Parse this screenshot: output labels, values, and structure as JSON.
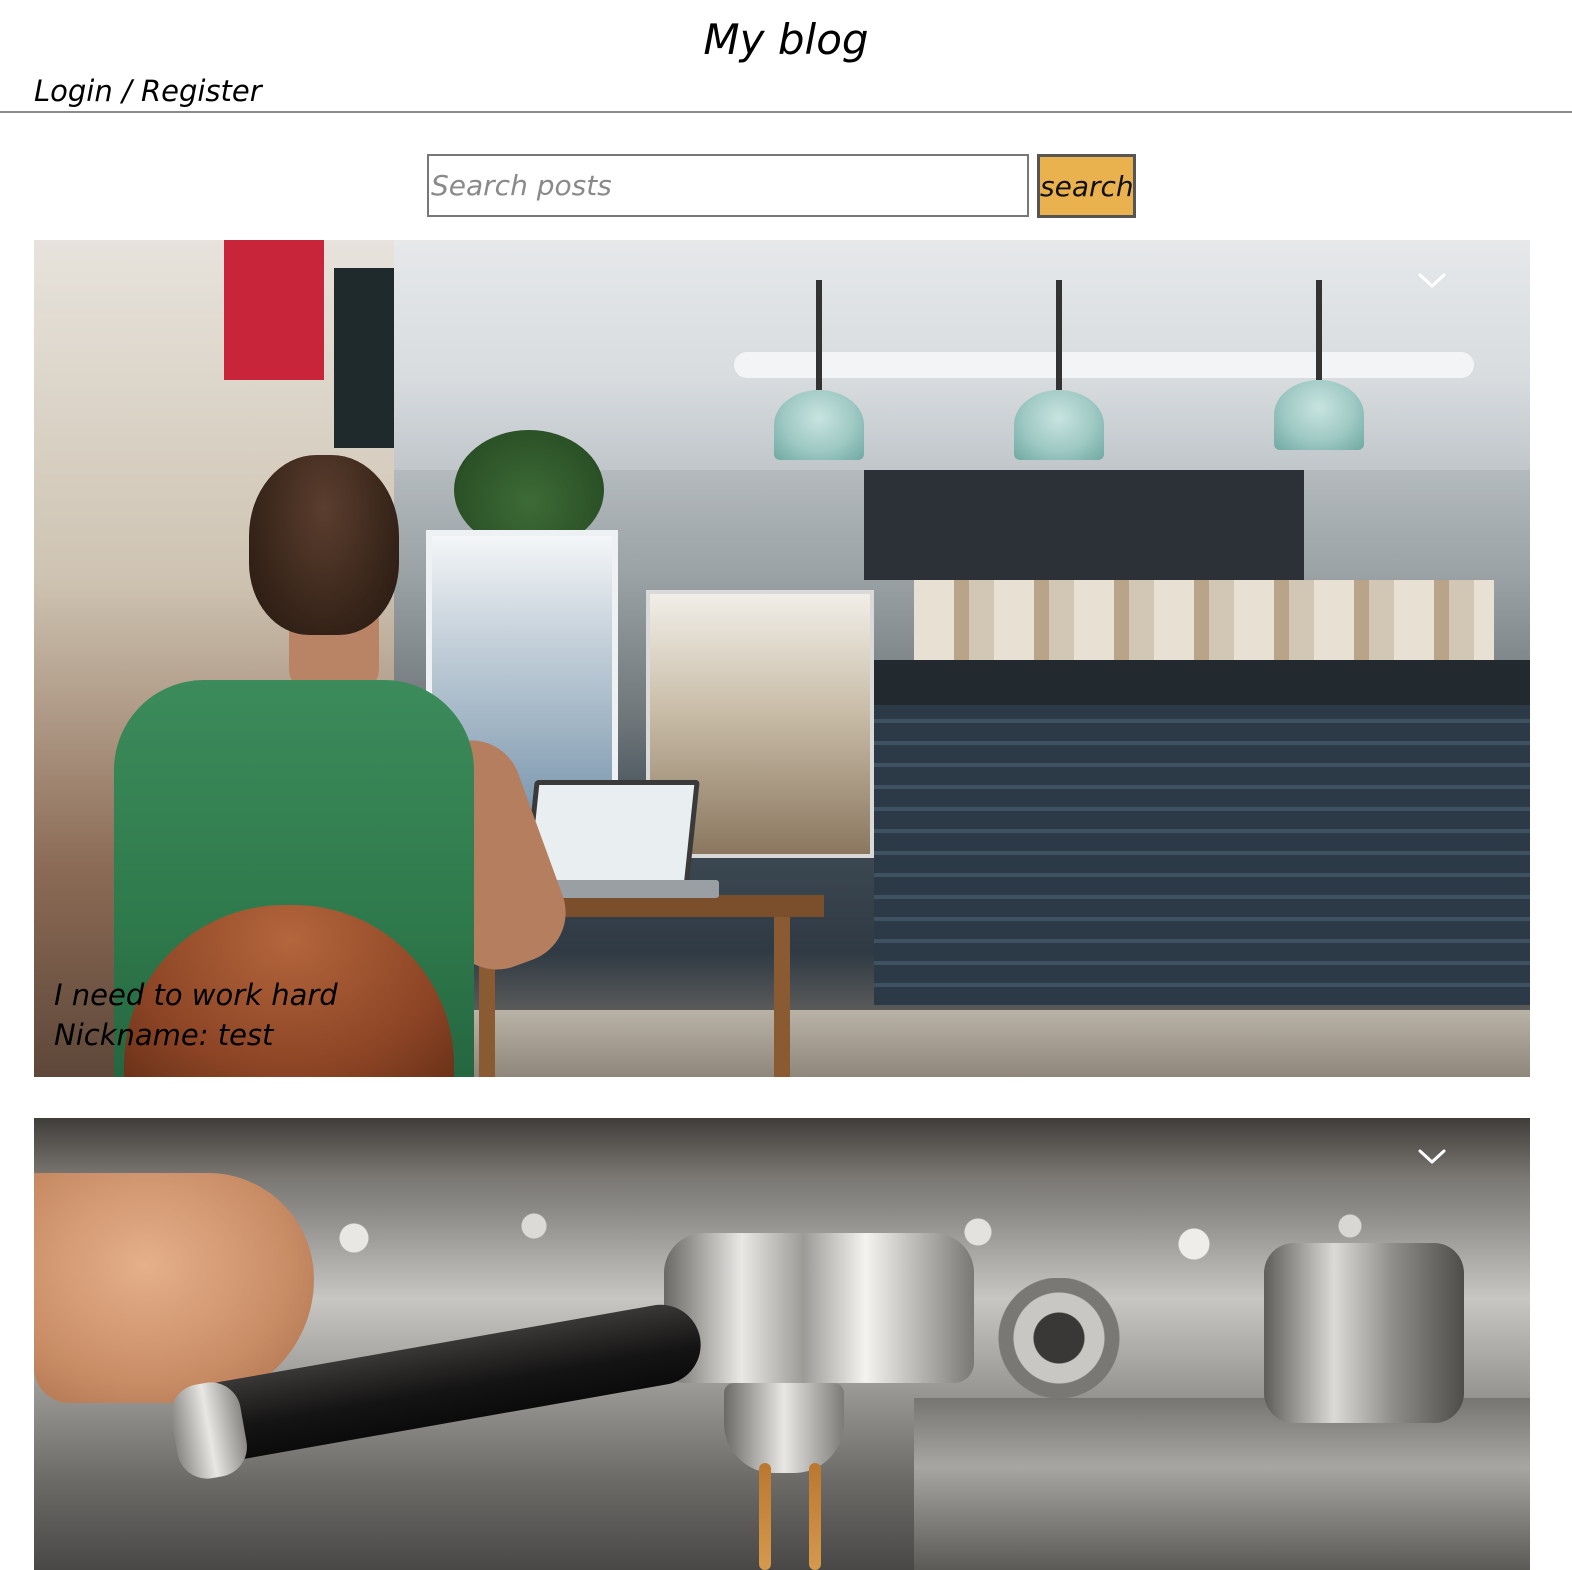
{
  "header": {
    "title": "My blog",
    "auth_link": "Login / Register"
  },
  "search": {
    "placeholder": "Search posts",
    "value": "",
    "button_label": "search",
    "button_color": "#e9b24f"
  },
  "posts": [
    {
      "image_icon": "photo-cafe-laptop",
      "caption": "I need to work hard",
      "nickname_line": "Nickname: test",
      "toggle_icon": "chevron-down-icon"
    },
    {
      "image_icon": "photo-espresso-machine",
      "toggle_icon": "chevron-down-icon"
    }
  ]
}
